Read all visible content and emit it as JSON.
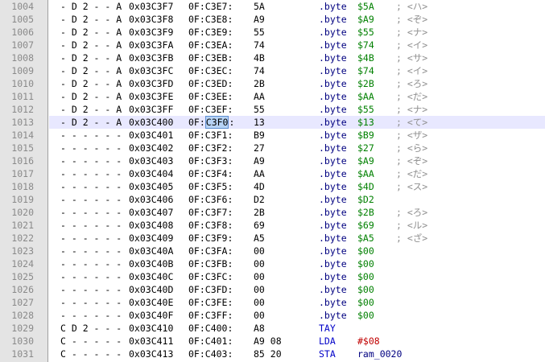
{
  "editor": {
    "gutter_background": "#e4e4e4",
    "current_line_highlight": "#e8e8ff",
    "selection_color": "#b7d3f5",
    "colors": {
      "line_number": "#8a8a8a",
      "directive": "#000080",
      "instruction": "#0000c8",
      "byte_value": "#008000",
      "immediate": "#c00000",
      "comment": "#909090"
    },
    "lines": [
      {
        "num": "1004",
        "flags": "- D 2 - - A",
        "addr": "0x03C3F7",
        "seg": "0F:C3E7:",
        "bytes": "5A",
        "mnem": ".byte",
        "operand": "$5A",
        "comment": "; <ハ>",
        "kind": "data"
      },
      {
        "num": "1005",
        "flags": "- D 2 - - A",
        "addr": "0x03C3F8",
        "seg": "0F:C3E8:",
        "bytes": "A9",
        "mnem": ".byte",
        "operand": "$A9",
        "comment": "; <ぞ>",
        "kind": "data"
      },
      {
        "num": "1006",
        "flags": "- D 2 - - A",
        "addr": "0x03C3F9",
        "seg": "0F:C3E9:",
        "bytes": "55",
        "mnem": ".byte",
        "operand": "$55",
        "comment": "; <ナ>",
        "kind": "data"
      },
      {
        "num": "1007",
        "flags": "- D 2 - - A",
        "addr": "0x03C3FA",
        "seg": "0F:C3EA:",
        "bytes": "74",
        "mnem": ".byte",
        "operand": "$74",
        "comment": "; <イ>",
        "kind": "data"
      },
      {
        "num": "1008",
        "flags": "- D 2 - - A",
        "addr": "0x03C3FB",
        "seg": "0F:C3EB:",
        "bytes": "4B",
        "mnem": ".byte",
        "operand": "$4B",
        "comment": "; <サ>",
        "kind": "data"
      },
      {
        "num": "1009",
        "flags": "- D 2 - - A",
        "addr": "0x03C3FC",
        "seg": "0F:C3EC:",
        "bytes": "74",
        "mnem": ".byte",
        "operand": "$74",
        "comment": "; <イ>",
        "kind": "data"
      },
      {
        "num": "1010",
        "flags": "- D 2 - - A",
        "addr": "0x03C3FD",
        "seg": "0F:C3ED:",
        "bytes": "2B",
        "mnem": ".byte",
        "operand": "$2B",
        "comment": "; <ろ>",
        "kind": "data"
      },
      {
        "num": "1011",
        "flags": "- D 2 - - A",
        "addr": "0x03C3FE",
        "seg": "0F:C3EE:",
        "bytes": "AA",
        "mnem": ".byte",
        "operand": "$AA",
        "comment": "; <だ>",
        "kind": "data"
      },
      {
        "num": "1012",
        "flags": "- D 2 - - A",
        "addr": "0x03C3FF",
        "seg": "0F:C3EF:",
        "bytes": "55",
        "mnem": ".byte",
        "operand": "$55",
        "comment": "; <ナ>",
        "kind": "data"
      },
      {
        "num": "1013",
        "flags": "- D 2 - - A",
        "addr": "0x03C400",
        "seg_prefix": "0F:",
        "seg_selected": "C3F0",
        "seg_suffix": ":",
        "bytes": "13",
        "mnem": ".byte",
        "operand": "$13",
        "comment": "; <て>",
        "kind": "data",
        "current": true
      },
      {
        "num": "1014",
        "flags": "- - - - - -",
        "addr": "0x03C401",
        "seg": "0F:C3F1:",
        "bytes": "B9",
        "mnem": ".byte",
        "operand": "$B9",
        "comment": "; <ザ>",
        "kind": "data"
      },
      {
        "num": "1015",
        "flags": "- - - - - -",
        "addr": "0x03C402",
        "seg": "0F:C3F2:",
        "bytes": "27",
        "mnem": ".byte",
        "operand": "$27",
        "comment": "; <ら>",
        "kind": "data"
      },
      {
        "num": "1016",
        "flags": "- - - - - -",
        "addr": "0x03C403",
        "seg": "0F:C3F3:",
        "bytes": "A9",
        "mnem": ".byte",
        "operand": "$A9",
        "comment": "; <ぞ>",
        "kind": "data"
      },
      {
        "num": "1017",
        "flags": "- - - - - -",
        "addr": "0x03C404",
        "seg": "0F:C3F4:",
        "bytes": "AA",
        "mnem": ".byte",
        "operand": "$AA",
        "comment": "; <だ>",
        "kind": "data"
      },
      {
        "num": "1018",
        "flags": "- - - - - -",
        "addr": "0x03C405",
        "seg": "0F:C3F5:",
        "bytes": "4D",
        "mnem": ".byte",
        "operand": "$4D",
        "comment": "; <ス>",
        "kind": "data"
      },
      {
        "num": "1019",
        "flags": "- - - - - -",
        "addr": "0x03C406",
        "seg": "0F:C3F6:",
        "bytes": "D2",
        "mnem": ".byte",
        "operand": "$D2",
        "comment": "",
        "kind": "data"
      },
      {
        "num": "1020",
        "flags": "- - - - - -",
        "addr": "0x03C407",
        "seg": "0F:C3F7:",
        "bytes": "2B",
        "mnem": ".byte",
        "operand": "$2B",
        "comment": "; <ろ>",
        "kind": "data"
      },
      {
        "num": "1021",
        "flags": "- - - - - -",
        "addr": "0x03C408",
        "seg": "0F:C3F8:",
        "bytes": "69",
        "mnem": ".byte",
        "operand": "$69",
        "comment": "; <ル>",
        "kind": "data"
      },
      {
        "num": "1022",
        "flags": "- - - - - -",
        "addr": "0x03C409",
        "seg": "0F:C3F9:",
        "bytes": "A5",
        "mnem": ".byte",
        "operand": "$A5",
        "comment": "; <ざ>",
        "kind": "data"
      },
      {
        "num": "1023",
        "flags": "- - - - - -",
        "addr": "0x03C40A",
        "seg": "0F:C3FA:",
        "bytes": "00",
        "mnem": ".byte",
        "operand": "$00",
        "comment": "",
        "kind": "data"
      },
      {
        "num": "1024",
        "flags": "- - - - - -",
        "addr": "0x03C40B",
        "seg": "0F:C3FB:",
        "bytes": "00",
        "mnem": ".byte",
        "operand": "$00",
        "comment": "",
        "kind": "data"
      },
      {
        "num": "1025",
        "flags": "- - - - - -",
        "addr": "0x03C40C",
        "seg": "0F:C3FC:",
        "bytes": "00",
        "mnem": ".byte",
        "operand": "$00",
        "comment": "",
        "kind": "data"
      },
      {
        "num": "1026",
        "flags": "- - - - - -",
        "addr": "0x03C40D",
        "seg": "0F:C3FD:",
        "bytes": "00",
        "mnem": ".byte",
        "operand": "$00",
        "comment": "",
        "kind": "data"
      },
      {
        "num": "1027",
        "flags": "- - - - - -",
        "addr": "0x03C40E",
        "seg": "0F:C3FE:",
        "bytes": "00",
        "mnem": ".byte",
        "operand": "$00",
        "comment": "",
        "kind": "data"
      },
      {
        "num": "1028",
        "flags": "- - - - - -",
        "addr": "0x03C40F",
        "seg": "0F:C3FF:",
        "bytes": "00",
        "mnem": ".byte",
        "operand": "$00",
        "comment": "",
        "kind": "data"
      },
      {
        "num": "1029",
        "flags": "C D 2 - - -",
        "addr": "0x03C410",
        "seg": "0F:C400:",
        "bytes": "A8",
        "mnem": "TAY",
        "operand": "",
        "comment": "",
        "kind": "code"
      },
      {
        "num": "1030",
        "flags": "C - - - - -",
        "addr": "0x03C411",
        "seg": "0F:C401:",
        "bytes": "A9 08",
        "mnem": "LDA",
        "operand": "#$08",
        "comment": "",
        "kind": "code",
        "operand_kind": "imm"
      },
      {
        "num": "1031",
        "flags": "C - - - - -",
        "addr": "0x03C413",
        "seg": "0F:C403:",
        "bytes": "85 20",
        "mnem": "STA",
        "operand": "ram_0020",
        "comment": "",
        "kind": "code",
        "operand_kind": "sym"
      }
    ]
  }
}
